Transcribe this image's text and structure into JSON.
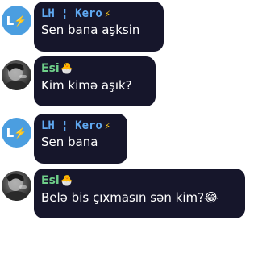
{
  "messages": [
    {
      "sender": "LH ¦ Kero",
      "badge": "⚡",
      "text": "Sen bana aşksin",
      "avatar": {
        "letter": "L",
        "badge": "⚡"
      }
    },
    {
      "sender": "Esi",
      "badge": "🐣",
      "text": "Kim kimə aşık?",
      "avatar": {
        "icon": "profile-photo"
      }
    },
    {
      "sender": "LH ¦ Kero",
      "badge": "⚡",
      "text": "Sen bana",
      "avatar": {
        "letter": "L",
        "badge": "⚡"
      }
    },
    {
      "sender": "Esi",
      "badge": "🐣",
      "text": "Belə bis çıxmasın sən kim?😂",
      "avatar": {
        "icon": "profile-photo"
      }
    }
  ],
  "colors": {
    "bubble": "#16162b",
    "lh_name": "#5fa8f0",
    "esi_name": "#6fd08a",
    "lh_avatar": "#4b9ee0"
  }
}
